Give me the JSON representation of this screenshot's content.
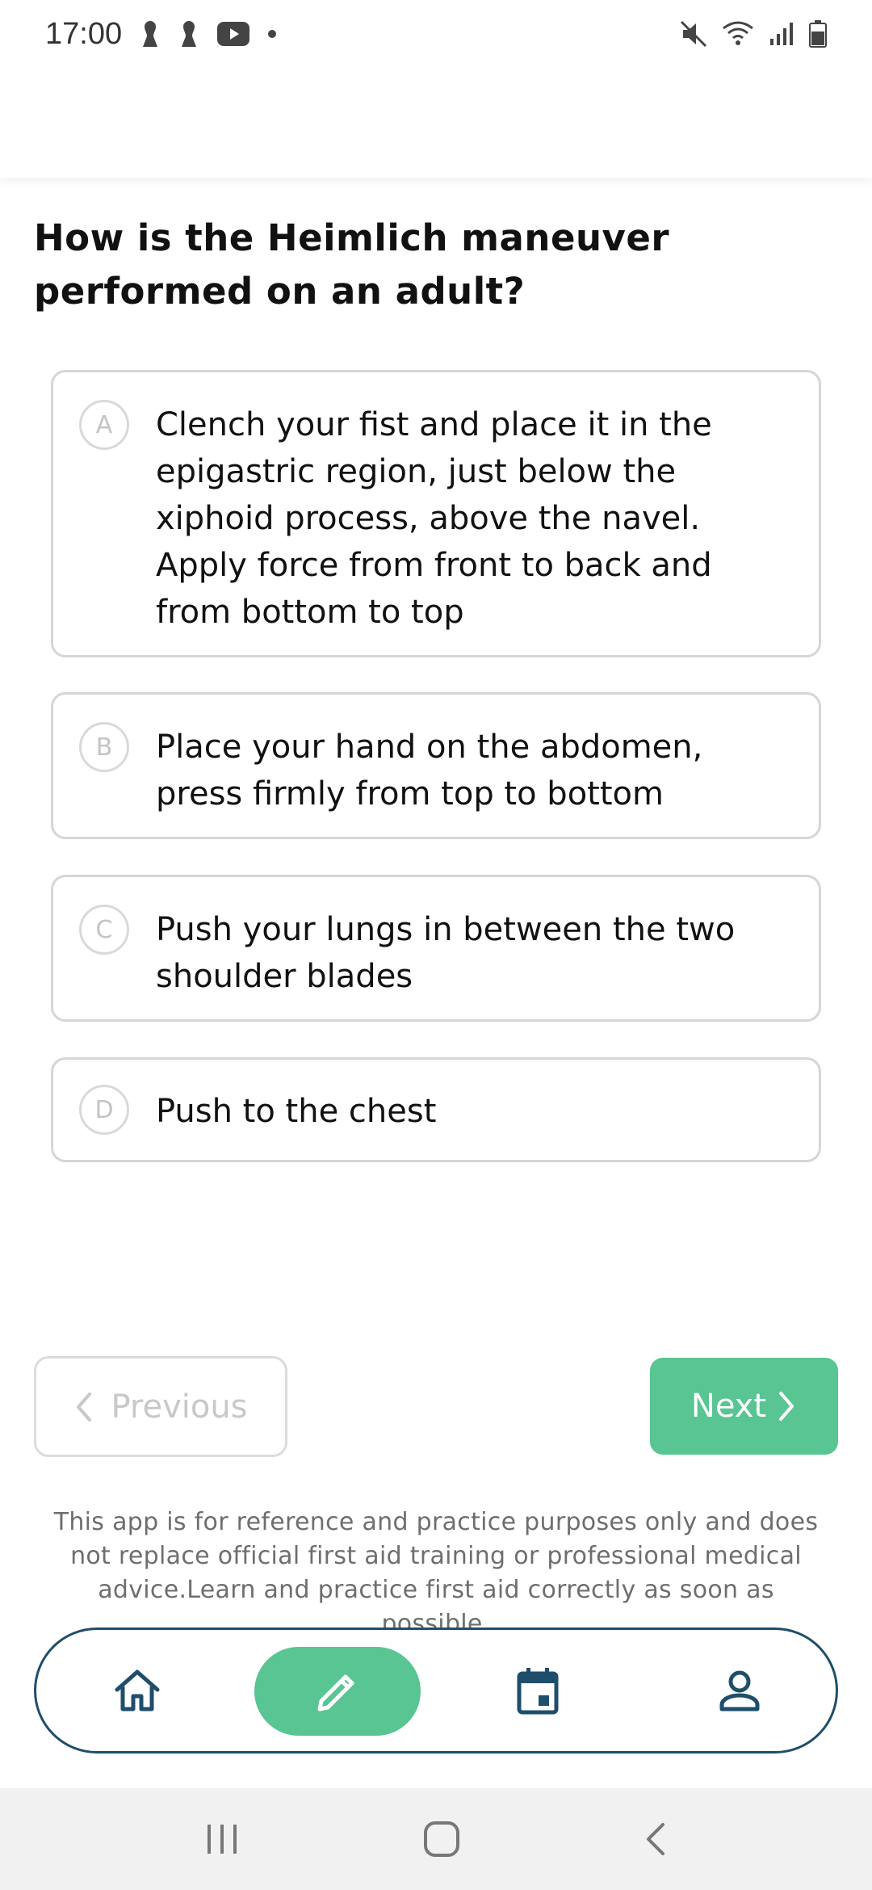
{
  "status_bar": {
    "time": "17:00",
    "left_icons": [
      "notification-icon",
      "notification-icon",
      "youtube-icon",
      "dot-icon"
    ],
    "right_icons": [
      "mute-icon",
      "wifi-icon",
      "signal-icon",
      "battery-icon"
    ]
  },
  "question": {
    "text": "How is the Heimlich maneuver performed on an adult?"
  },
  "options": [
    {
      "letter": "A",
      "text": "Clench your fist and place it in the epigastric region, just below the xiphoid process, above the navel. Apply force from front to back and from bottom to top"
    },
    {
      "letter": "B",
      "text": "Place your hand on the abdomen, press firmly from top to bottom"
    },
    {
      "letter": "C",
      "text": "Push your lungs in between the two shoulder blades"
    },
    {
      "letter": "D",
      "text": "Push to the chest"
    }
  ],
  "navigation": {
    "previous_label": "Previous",
    "next_label": "Next"
  },
  "disclaimer": "This app is for reference and practice purposes only and does not replace official first aid training or professional medical advice.Learn and practice first aid correctly as soon as possible.",
  "bottom_nav": {
    "items": [
      "home-icon",
      "pencil-icon",
      "calendar-icon",
      "profile-icon"
    ],
    "active": "pencil-icon"
  },
  "colors": {
    "accent": "#58c592",
    "nav_border": "#1f4e6b"
  }
}
